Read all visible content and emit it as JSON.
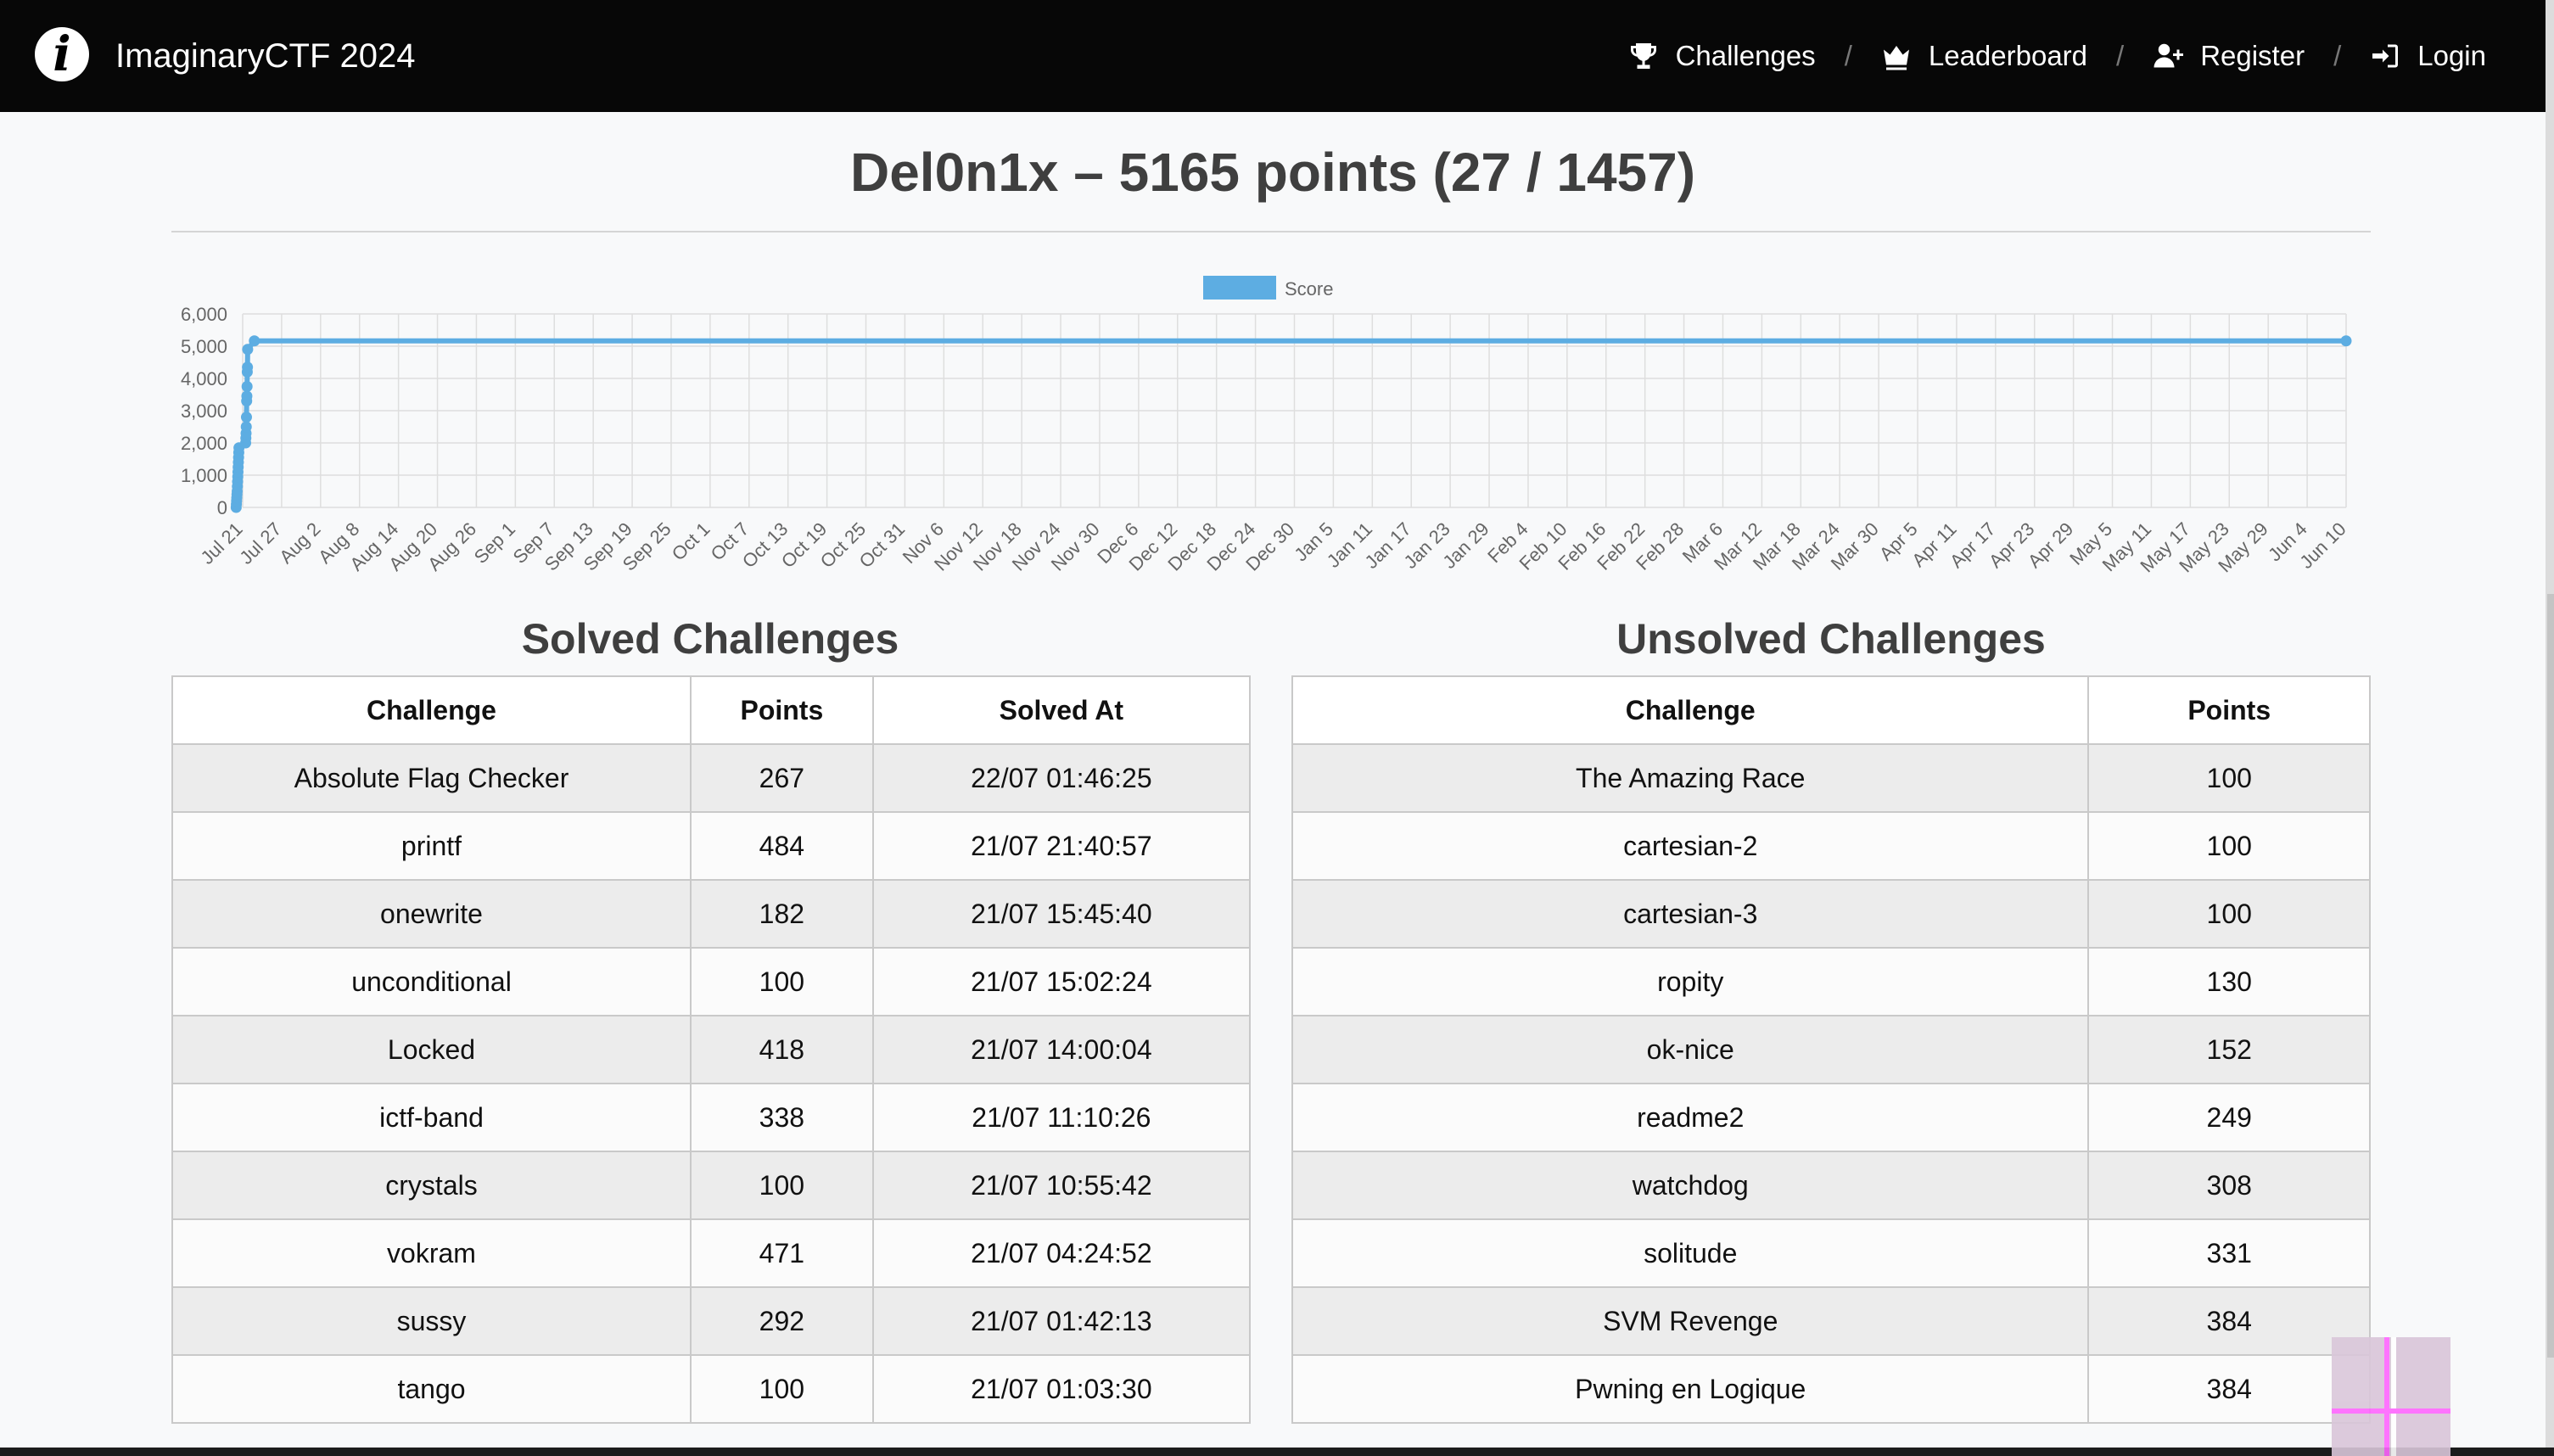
{
  "app": {
    "brand": "ImaginaryCTF 2024",
    "logo_letter": "i"
  },
  "nav": {
    "challenges": "Challenges",
    "leaderboard": "Leaderboard",
    "register": "Register",
    "login": "Login",
    "separator": "/"
  },
  "page": {
    "title": "Del0n1x – 5165 points (27 / 1457)"
  },
  "chart_data": {
    "type": "line",
    "legend": [
      "Score"
    ],
    "legend_position": "top-center",
    "series": [
      {
        "name": "Score",
        "color": "#5dade2",
        "points": [
          [
            "Jul 20",
            0
          ],
          [
            "Jul 20",
            100
          ],
          [
            "Jul 20",
            200
          ],
          [
            "Jul 20",
            300
          ],
          [
            "Jul 20",
            400
          ],
          [
            "Jul 20",
            500
          ],
          [
            "Jul 20",
            650
          ],
          [
            "Jul 20",
            800
          ],
          [
            "Jul 20",
            950
          ],
          [
            "Jul 20",
            1100
          ],
          [
            "Jul 20",
            1250
          ],
          [
            "Jul 20",
            1400
          ],
          [
            "Jul 20",
            1550
          ],
          [
            "Jul 20",
            1700
          ],
          [
            "Jul 20",
            1850
          ],
          [
            "Jul 21",
            2000
          ],
          [
            "Jul 21",
            2150
          ],
          [
            "Jul 21",
            2300
          ],
          [
            "Jul 21",
            2500
          ],
          [
            "Jul 21",
            2800
          ],
          [
            "Jul 21",
            3300
          ],
          [
            "Jul 21",
            3450
          ],
          [
            "Jul 21",
            3750
          ],
          [
            "Jul 21",
            4200
          ],
          [
            "Jul 21",
            4350
          ],
          [
            "Jul 21",
            4900
          ],
          [
            "Jul 22",
            5165
          ],
          [
            "Jun 10",
            5165
          ]
        ]
      }
    ],
    "y_ticks": [
      "0",
      "1,000",
      "2,000",
      "3,000",
      "4,000",
      "5,000",
      "6,000"
    ],
    "ylim": [
      0,
      6000
    ],
    "x_ticks": [
      "Jul 21",
      "Jul 27",
      "Aug 2",
      "Aug 8",
      "Aug 14",
      "Aug 20",
      "Aug 26",
      "Sep 1",
      "Sep 7",
      "Sep 13",
      "Sep 19",
      "Sep 25",
      "Oct 1",
      "Oct 7",
      "Oct 13",
      "Oct 19",
      "Oct 25",
      "Oct 31",
      "Nov 6",
      "Nov 12",
      "Nov 18",
      "Nov 24",
      "Nov 30",
      "Dec 6",
      "Dec 12",
      "Dec 18",
      "Dec 24",
      "Dec 30",
      "Jan 5",
      "Jan 11",
      "Jan 17",
      "Jan 23",
      "Jan 29",
      "Feb 4",
      "Feb 10",
      "Feb 16",
      "Feb 22",
      "Feb 28",
      "Mar 6",
      "Mar 12",
      "Mar 18",
      "Mar 24",
      "Mar 30",
      "Apr 5",
      "Apr 11",
      "Apr 17",
      "Apr 23",
      "Apr 29",
      "May 5",
      "May 11",
      "May 17",
      "May 23",
      "May 29",
      "Jun 4",
      "Jun 10"
    ],
    "grid": true
  },
  "solved": {
    "title": "Solved Challenges",
    "headers": [
      "Challenge",
      "Points",
      "Solved At"
    ],
    "rows": [
      [
        "Absolute Flag Checker",
        "267",
        "22/07 01:46:25"
      ],
      [
        "printf",
        "484",
        "21/07 21:40:57"
      ],
      [
        "onewrite",
        "182",
        "21/07 15:45:40"
      ],
      [
        "unconditional",
        "100",
        "21/07 15:02:24"
      ],
      [
        "Locked",
        "418",
        "21/07 14:00:04"
      ],
      [
        "ictf-band",
        "338",
        "21/07 11:10:26"
      ],
      [
        "crystals",
        "100",
        "21/07 10:55:42"
      ],
      [
        "vokram",
        "471",
        "21/07 04:24:52"
      ],
      [
        "sussy",
        "292",
        "21/07 01:42:13"
      ],
      [
        "tango",
        "100",
        "21/07 01:03:30"
      ]
    ]
  },
  "unsolved": {
    "title": "Unsolved Challenges",
    "headers": [
      "Challenge",
      "Points"
    ],
    "rows": [
      [
        "The Amazing Race",
        "100"
      ],
      [
        "cartesian-2",
        "100"
      ],
      [
        "cartesian-3",
        "100"
      ],
      [
        "ropity",
        "130"
      ],
      [
        "ok-nice",
        "152"
      ],
      [
        "readme2",
        "249"
      ],
      [
        "watchdog",
        "308"
      ],
      [
        "solitude",
        "331"
      ],
      [
        "SVM Revenge",
        "384"
      ],
      [
        "Pwning en Logique",
        "384"
      ]
    ]
  }
}
